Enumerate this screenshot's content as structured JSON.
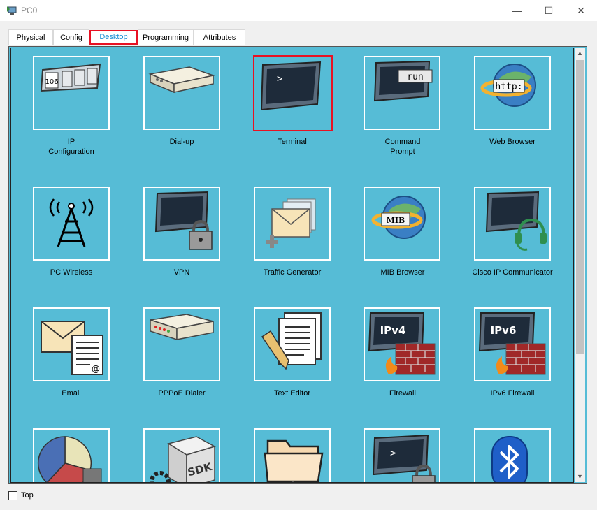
{
  "window": {
    "title": "PC0",
    "minimize": "—",
    "maximize": "☐",
    "close": "✕"
  },
  "tabs": [
    {
      "label": "Physical"
    },
    {
      "label": "Config"
    },
    {
      "label": "Desktop",
      "active": true
    },
    {
      "label": "Programming"
    },
    {
      "label": "Attributes"
    }
  ],
  "apps": [
    {
      "label": "IP\nConfiguration",
      "icon": "ip-config-icon",
      "badge": "106"
    },
    {
      "label": "Dial-up",
      "icon": "modem-icon"
    },
    {
      "label": "Terminal",
      "icon": "terminal-icon",
      "badge": ">",
      "selected": true
    },
    {
      "label": "Command\nPrompt",
      "icon": "command-prompt-icon",
      "badge": "run"
    },
    {
      "label": "Web Browser",
      "icon": "web-browser-icon",
      "badge": "http:"
    },
    {
      "label": "PC Wireless",
      "icon": "wireless-antenna-icon"
    },
    {
      "label": "VPN",
      "icon": "vpn-lock-icon"
    },
    {
      "label": "Traffic Generator",
      "icon": "traffic-generator-icon"
    },
    {
      "label": "MIB Browser",
      "icon": "mib-browser-icon",
      "badge": "MIB"
    },
    {
      "label": "Cisco IP Communicator",
      "icon": "headset-icon"
    },
    {
      "label": "Email",
      "icon": "email-icon",
      "badge": "@"
    },
    {
      "label": "PPPoE Dialer",
      "icon": "pppoe-modem-icon"
    },
    {
      "label": "Text Editor",
      "icon": "text-editor-icon"
    },
    {
      "label": "Firewall",
      "icon": "firewall-icon",
      "badge": "IPv4"
    },
    {
      "label": "IPv6 Firewall",
      "icon": "ipv6-firewall-icon",
      "badge": "IPv6"
    },
    {
      "label": "",
      "icon": "pie-chart-icon"
    },
    {
      "label": "",
      "icon": "sdk-icon",
      "badge": "SDK"
    },
    {
      "label": "",
      "icon": "folder-icon"
    },
    {
      "label": "",
      "icon": "terminal-lock-icon",
      "badge": ">"
    },
    {
      "label": "",
      "icon": "bluetooth-icon"
    }
  ],
  "footer": {
    "top_label": "Top",
    "top_checked": false
  },
  "colors": {
    "panel_bg": "#56bcd6",
    "selected_border": "#e81123",
    "active_tab_text": "#1a8fd6"
  }
}
